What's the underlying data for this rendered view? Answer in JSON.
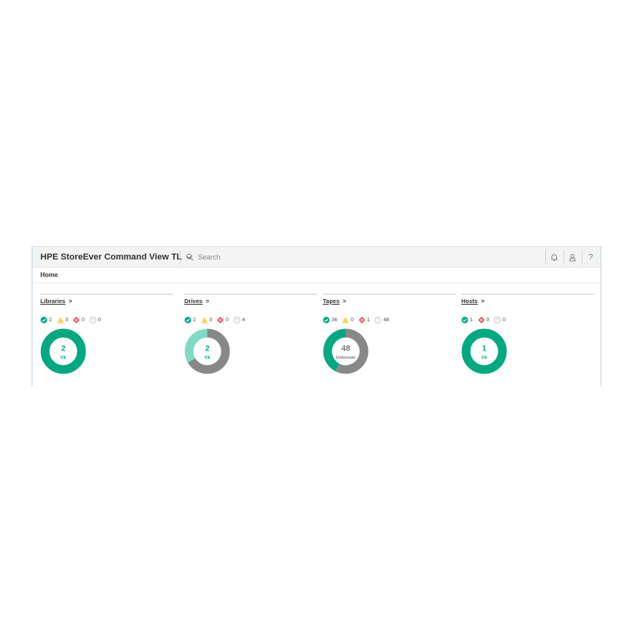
{
  "header": {
    "app_title": "HPE StoreEver Command View TL",
    "search_placeholder": "Search"
  },
  "breadcrumb": {
    "home": "Home"
  },
  "colors": {
    "ok": "#01a982",
    "ok_light": "#7fd9c3",
    "unknown": "#888888",
    "warning": "#ffd144",
    "critical": "#e5484d",
    "unknown_icon": "#bbbbbb"
  },
  "cards": [
    {
      "title": "Libraries",
      "arrow": ">",
      "statuses": {
        "ok": "2",
        "warning": "0",
        "critical": "0",
        "unknown": "0"
      },
      "donut": {
        "center_value": "2",
        "center_label": "Ok",
        "center_color": "#01a982",
        "segments": [
          {
            "status": "ok",
            "value": 2,
            "color": "#01a982"
          }
        ]
      }
    },
    {
      "title": "Drives",
      "arrow": ">",
      "statuses": {
        "ok": "2",
        "warning": "0",
        "critical": "0",
        "unknown": "4"
      },
      "donut": {
        "center_value": "2",
        "center_label": "Ok",
        "center_color": "#01a982",
        "segments": [
          {
            "status": "unknown",
            "value": 4,
            "color": "#888888"
          },
          {
            "status": "ok",
            "value": 2,
            "color": "#7fd9c3"
          }
        ]
      }
    },
    {
      "title": "Tapes",
      "arrow": ">",
      "statuses": {
        "ok": "36",
        "warning": "0",
        "critical": "1",
        "unknown": "48"
      },
      "donut": {
        "center_value": "48",
        "center_label": "Unknown",
        "center_color": "#777777",
        "segments": [
          {
            "status": "unknown",
            "value": 48,
            "color": "#888888"
          },
          {
            "status": "critical",
            "value": 1,
            "color": "#888888"
          },
          {
            "status": "ok",
            "value": 36,
            "color": "#01a982"
          }
        ]
      }
    },
    {
      "title": "Hosts",
      "arrow": ">",
      "statuses": {
        "ok": "1",
        "critical": "0",
        "unknown": "0"
      },
      "donut": {
        "center_value": "1",
        "center_label": "Ok",
        "center_color": "#01a982",
        "segments": [
          {
            "status": "ok",
            "value": 1,
            "color": "#01a982"
          }
        ]
      }
    }
  ]
}
